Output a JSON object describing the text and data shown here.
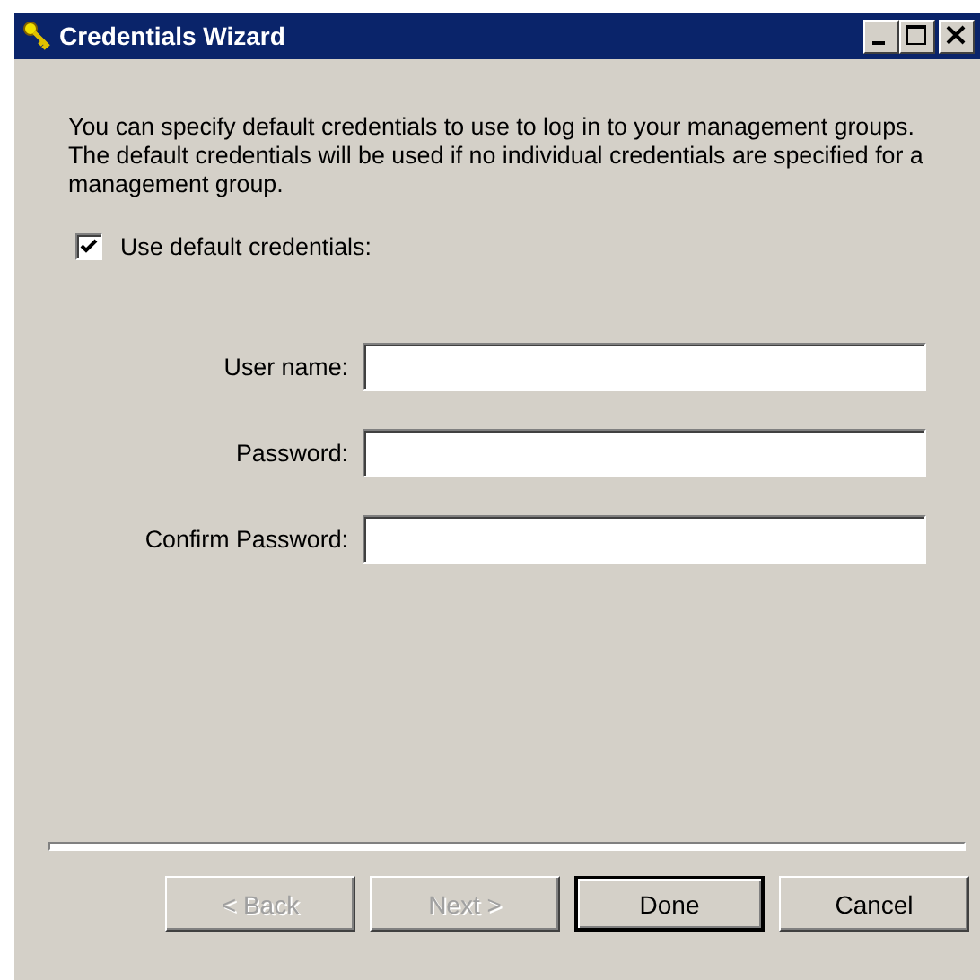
{
  "window": {
    "title": "Credentials Wizard"
  },
  "intro": "You can specify default credentials to use to log in to your management groups. The default credentials will be used if no individual credentials are specified for a management group.",
  "use_default": {
    "label": "Use default credentials:",
    "checked": true
  },
  "fields": [
    {
      "label": "User name:"
    },
    {
      "label": "Password:"
    },
    {
      "label": "Confirm Password:"
    }
  ],
  "buttons": [
    {
      "label": "< Back",
      "disabled": true,
      "default": false
    },
    {
      "label": "Next >",
      "disabled": true,
      "default": false
    },
    {
      "label": "Done",
      "disabled": false,
      "default": true
    },
    {
      "label": "Cancel",
      "disabled": false,
      "default": false
    }
  ]
}
